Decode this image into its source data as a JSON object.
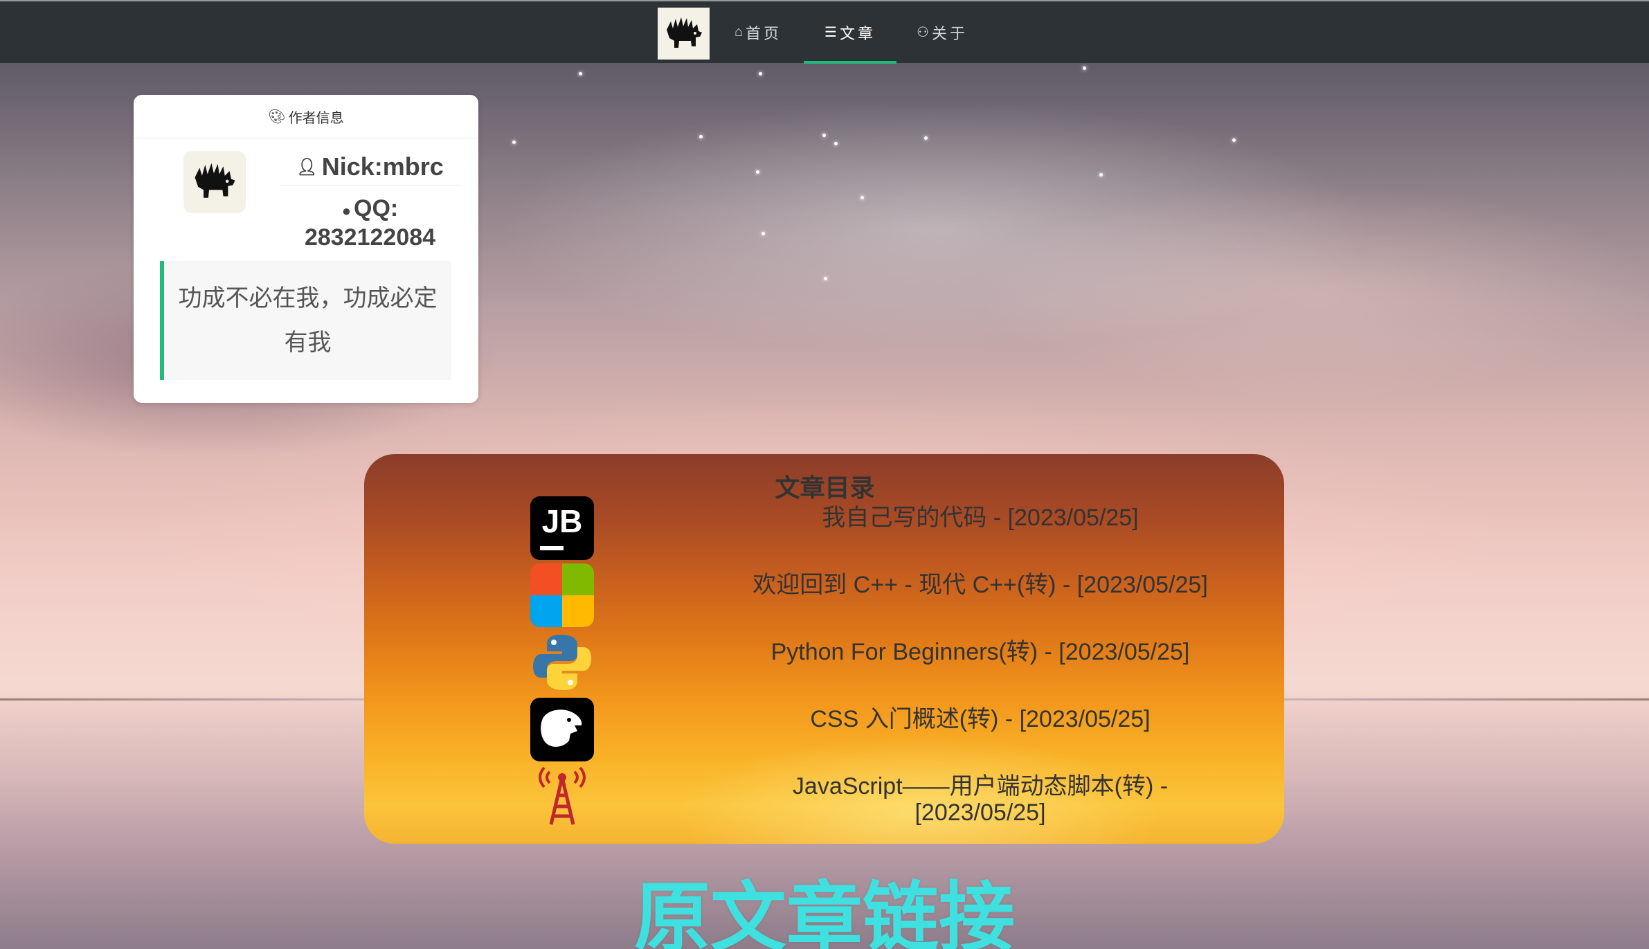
{
  "nav": {
    "items": [
      {
        "icon": "home-icon",
        "glyph": "⌂",
        "label": "首页",
        "active": false
      },
      {
        "icon": "sliders-icon",
        "glyph": "☰",
        "label": "文章",
        "active": true
      },
      {
        "icon": "user-icon",
        "glyph": "⚇",
        "label": "关于",
        "active": false
      }
    ]
  },
  "author": {
    "header_label": "作者信息",
    "nick": "Nick:mbrc",
    "qq_label": "QQ:",
    "qq_number": "2832122084",
    "motto": "功成不必在我，功成必定有我"
  },
  "catalog": {
    "title": "文章目录",
    "articles": [
      {
        "icon": "jetbrains-icon",
        "text": "我自己写的代码 - [2023/05/25]"
      },
      {
        "icon": "microsoft-icon",
        "text": "欢迎回到 C++ - 现代 C++(转) - [2023/05/25]"
      },
      {
        "icon": "python-icon",
        "text": "Python For Beginners(转) - [2023/05/25]"
      },
      {
        "icon": "css-icon",
        "text": "CSS 入门概述(转) - [2023/05/25]"
      },
      {
        "icon": "javascript-icon",
        "text": "JavaScript——用户端动态脚本(转) - [2023/05/25]"
      }
    ]
  },
  "footer": {
    "heading": "原文章链接"
  },
  "colors": {
    "nav_bg": "#2c3236",
    "accent_green": "#21ba7a",
    "heading_cyan": "#3ee0e0"
  }
}
